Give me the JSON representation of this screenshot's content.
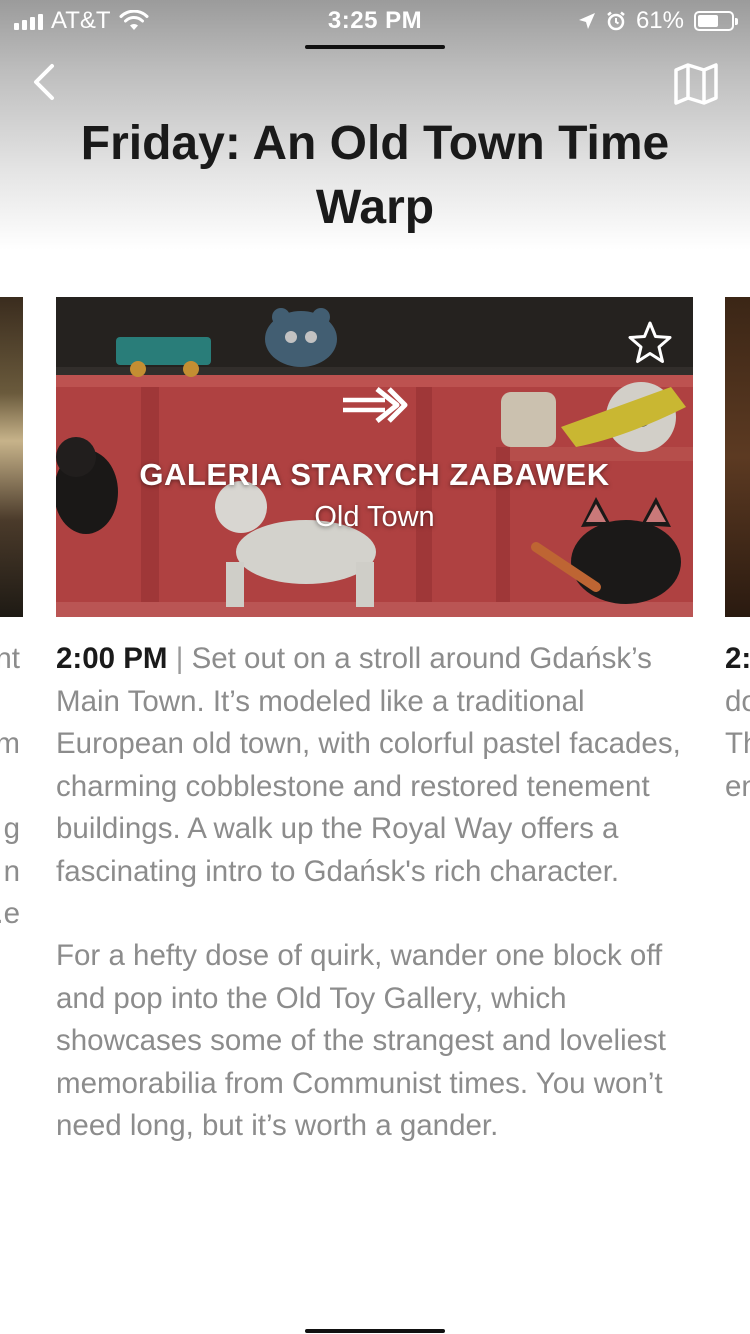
{
  "status_bar": {
    "carrier": "AT&T",
    "time": "3:25 PM",
    "battery": "61%",
    "battery_level": 0.61
  },
  "header": {
    "title": "Friday: An Old Town Time Warp",
    "back_icon": "chevron-left-icon",
    "map_icon": "map-icon"
  },
  "card": {
    "name": "GALERIA STARYCH ZABAWEK",
    "area": "Old Town",
    "favorite_icon": "star-outline-icon",
    "open_icon": "double-arrow-right-icon"
  },
  "content": {
    "time": "2:00 PM",
    "separator": "|",
    "paragraph1": "Set out on a stroll around Gdańsk’s Main Town. It’s modeled like a traditional European old town, with colorful pastel facades, charming cobblestone and restored tenement buildings. A walk up the Royal Way offers a fascinating intro to Gdańsk's rich character.",
    "paragraph2": "For a hefty dose of quirk, wander one block off and pop into the Old Toy Gallery, which showcases some of the strangest and loveliest memorabilia from Communist times. You won’t need long, but it’s worth a gander."
  },
  "adjacent_left_fragments": [
    "nt",
    "",
    "m",
    "",
    "g",
    "n",
    "e."
  ],
  "adjacent_right_fragments": [
    "2:",
    "do",
    "Th",
    "en"
  ]
}
